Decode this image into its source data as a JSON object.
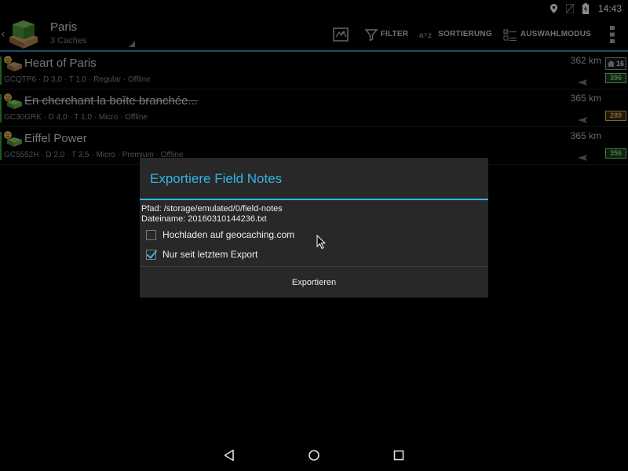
{
  "status_bar": {
    "icons": [
      "location-icon",
      "no-sim-icon",
      "battery-charging-icon"
    ],
    "time": "14:43"
  },
  "action_bar": {
    "title": "Paris",
    "subtitle": "3 Caches",
    "actions": {
      "map": "map-icon",
      "filter": "FILTER",
      "sort": "SORTIERUNG",
      "select_mode": "AUSWAHLMODUS",
      "overflow": "overflow-menu-icon"
    },
    "accent_color": "#1f8fc4"
  },
  "cache_list": [
    {
      "name": "Heart of Paris",
      "info": "GCQTP6 · D 3,0 · T 1,0 · Regular · Offline",
      "distance": "362 km",
      "inventory": "16",
      "favorites": "396",
      "fav_color": "green",
      "struck": false
    },
    {
      "name": "En cherchant la boîte branchée...",
      "info": "GC30GRK · D 4,0 · T 1,0 · Micro · Offline",
      "distance": "365 km",
      "inventory": "",
      "favorites": "289",
      "fav_color": "gold",
      "struck": true
    },
    {
      "name": "Eiffel Power",
      "info": "GC5552H · D 2,0 · T 3,5 · Micro · Premium · Offline",
      "distance": "365 km",
      "inventory": "",
      "favorites": "356",
      "fav_color": "green",
      "struck": false
    }
  ],
  "dialog": {
    "title": "Exportiere Field Notes",
    "path_line": "Pfad: /storage/emulated/0/field-notes",
    "filename_line": "Dateiname: 20160310144236.txt",
    "checkboxes": [
      {
        "label": "Hochladen auf geocaching.com",
        "checked": false
      },
      {
        "label": "Nur seit letztem Export",
        "checked": true
      }
    ],
    "button": "Exportieren",
    "accent_color": "#33b5e5"
  },
  "nav_bar": {
    "icons": [
      "back-icon",
      "home-icon",
      "recents-icon"
    ]
  }
}
